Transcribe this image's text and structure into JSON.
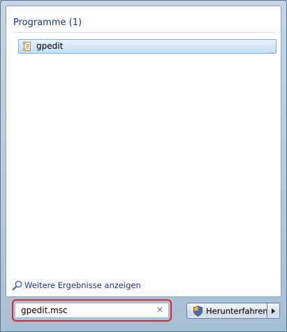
{
  "start_menu": {
    "results": {
      "group_heading": "Programme (1)",
      "items": [
        {
          "label": "gpedit",
          "icon": "policy-document-icon",
          "selected": true
        }
      ]
    },
    "more_results_label": "Weitere Ergebnisse anzeigen",
    "more_results_icon": "search-magnifier-icon",
    "search": {
      "value": "gpedit.msc",
      "clear_glyph": "×",
      "highlight_color": "#e0262f"
    },
    "shutdown": {
      "label": "Herunterfahren",
      "icon": "uac-shield-icon",
      "arrow_icon": "arrow-right-icon"
    }
  }
}
